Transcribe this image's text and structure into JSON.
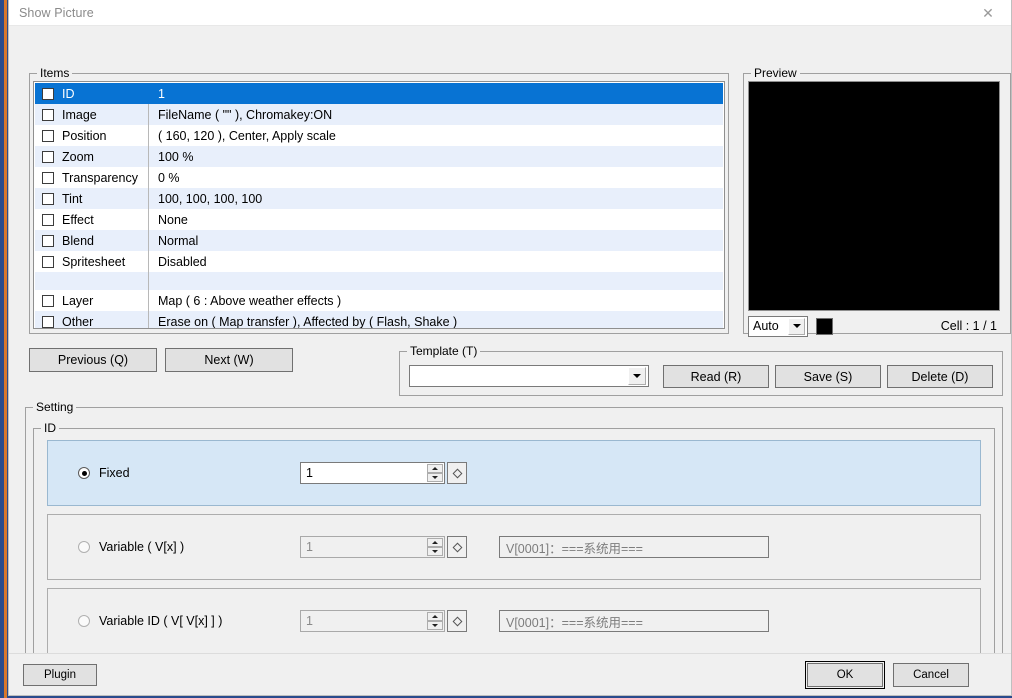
{
  "window": {
    "title": "Show Picture",
    "close_label": "✕"
  },
  "items": {
    "group_label": "Items",
    "rows": [
      {
        "name": "ID",
        "value": "1"
      },
      {
        "name": "Image",
        "value": "FileName ( \"\" ), Chromakey:ON"
      },
      {
        "name": "Position",
        "value": "( 160, 120 ), Center, Apply scale"
      },
      {
        "name": "Zoom",
        "value": "100 %"
      },
      {
        "name": "Transparency",
        "value": "0 %"
      },
      {
        "name": "Tint",
        "value": "100, 100, 100, 100"
      },
      {
        "name": "Effect",
        "value": "None"
      },
      {
        "name": "Blend",
        "value": "Normal"
      },
      {
        "name": "Spritesheet",
        "value": "Disabled"
      },
      {
        "name": "",
        "value": ""
      },
      {
        "name": "Layer",
        "value": "Map ( 6 : Above weather effects )"
      },
      {
        "name": "Other",
        "value": "Erase on ( Map transfer ), Affected by ( Flash, Shake )"
      }
    ]
  },
  "preview": {
    "group_label": "Preview",
    "canvas_color": "#000000",
    "scale_mode": "Auto",
    "background_color": "#000000",
    "cell_label": "Cell : 1 / 1"
  },
  "nav": {
    "previous_label": "Previous (Q)",
    "next_label": "Next (W)"
  },
  "template": {
    "group_label": "Template (T)",
    "selected": "",
    "read_label": "Read (R)",
    "save_label": "Save (S)",
    "delete_label": "Delete (D)"
  },
  "setting": {
    "group_label": "Setting",
    "id_group_label": "ID",
    "options": [
      {
        "label": "Fixed",
        "selected": true,
        "spinner_value": "1",
        "spinner_disabled": false,
        "variable_name": null
      },
      {
        "label": "Variable ( V[x] )",
        "selected": false,
        "spinner_value": "1",
        "spinner_disabled": true,
        "variable_name": "V[0001]：===系统用==="
      },
      {
        "label": "Variable ID ( V[ V[x] ] )",
        "selected": false,
        "spinner_value": "1",
        "spinner_disabled": true,
        "variable_name": "V[0001]：===系统用==="
      }
    ]
  },
  "footer": {
    "plugin_label": "Plugin",
    "ok_label": "OK",
    "cancel_label": "Cancel"
  },
  "colors": {
    "selection_blue": "#0873d3",
    "alt_row": "#e8effb",
    "active_panel": "#d6e7f6",
    "dialog_face": "#f0f0f0"
  }
}
